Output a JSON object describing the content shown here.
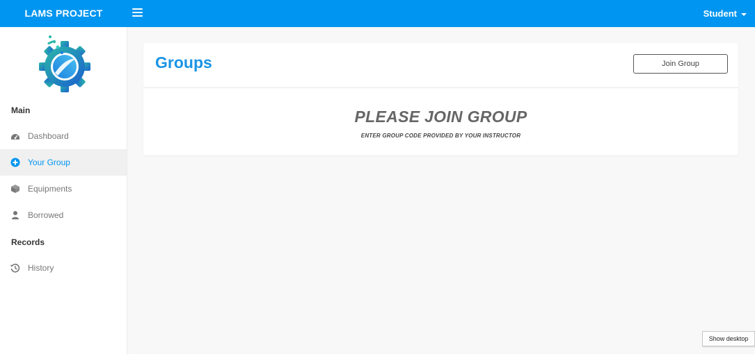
{
  "topbar": {
    "brand": "LAMS PROJECT",
    "menu_icon": "hamburger-menu-icon",
    "user_label": "Student",
    "accent_color": "#0095f0"
  },
  "sidebar": {
    "logo_icon": "gear-logo-icon",
    "sections": [
      {
        "label": "Main",
        "items": [
          {
            "label": "Dashboard",
            "icon": "dashboard-icon",
            "active": false
          },
          {
            "label": "Your Group",
            "icon": "plus-circle-icon",
            "active": true
          },
          {
            "label": "Equipments",
            "icon": "box-icon",
            "active": false
          },
          {
            "label": "Borrowed",
            "icon": "user-icon",
            "active": false
          }
        ]
      },
      {
        "label": "Records",
        "items": [
          {
            "label": "History",
            "icon": "history-icon",
            "active": false
          }
        ]
      }
    ]
  },
  "main": {
    "title": "Groups",
    "join_button": "Join Group",
    "headline": "PLEASE JOIN GROUP",
    "subline": "ENTER GROUP CODE PROVIDED BY YOUR INSTRUCTOR"
  },
  "tooltip": {
    "text": "Show desktop"
  }
}
